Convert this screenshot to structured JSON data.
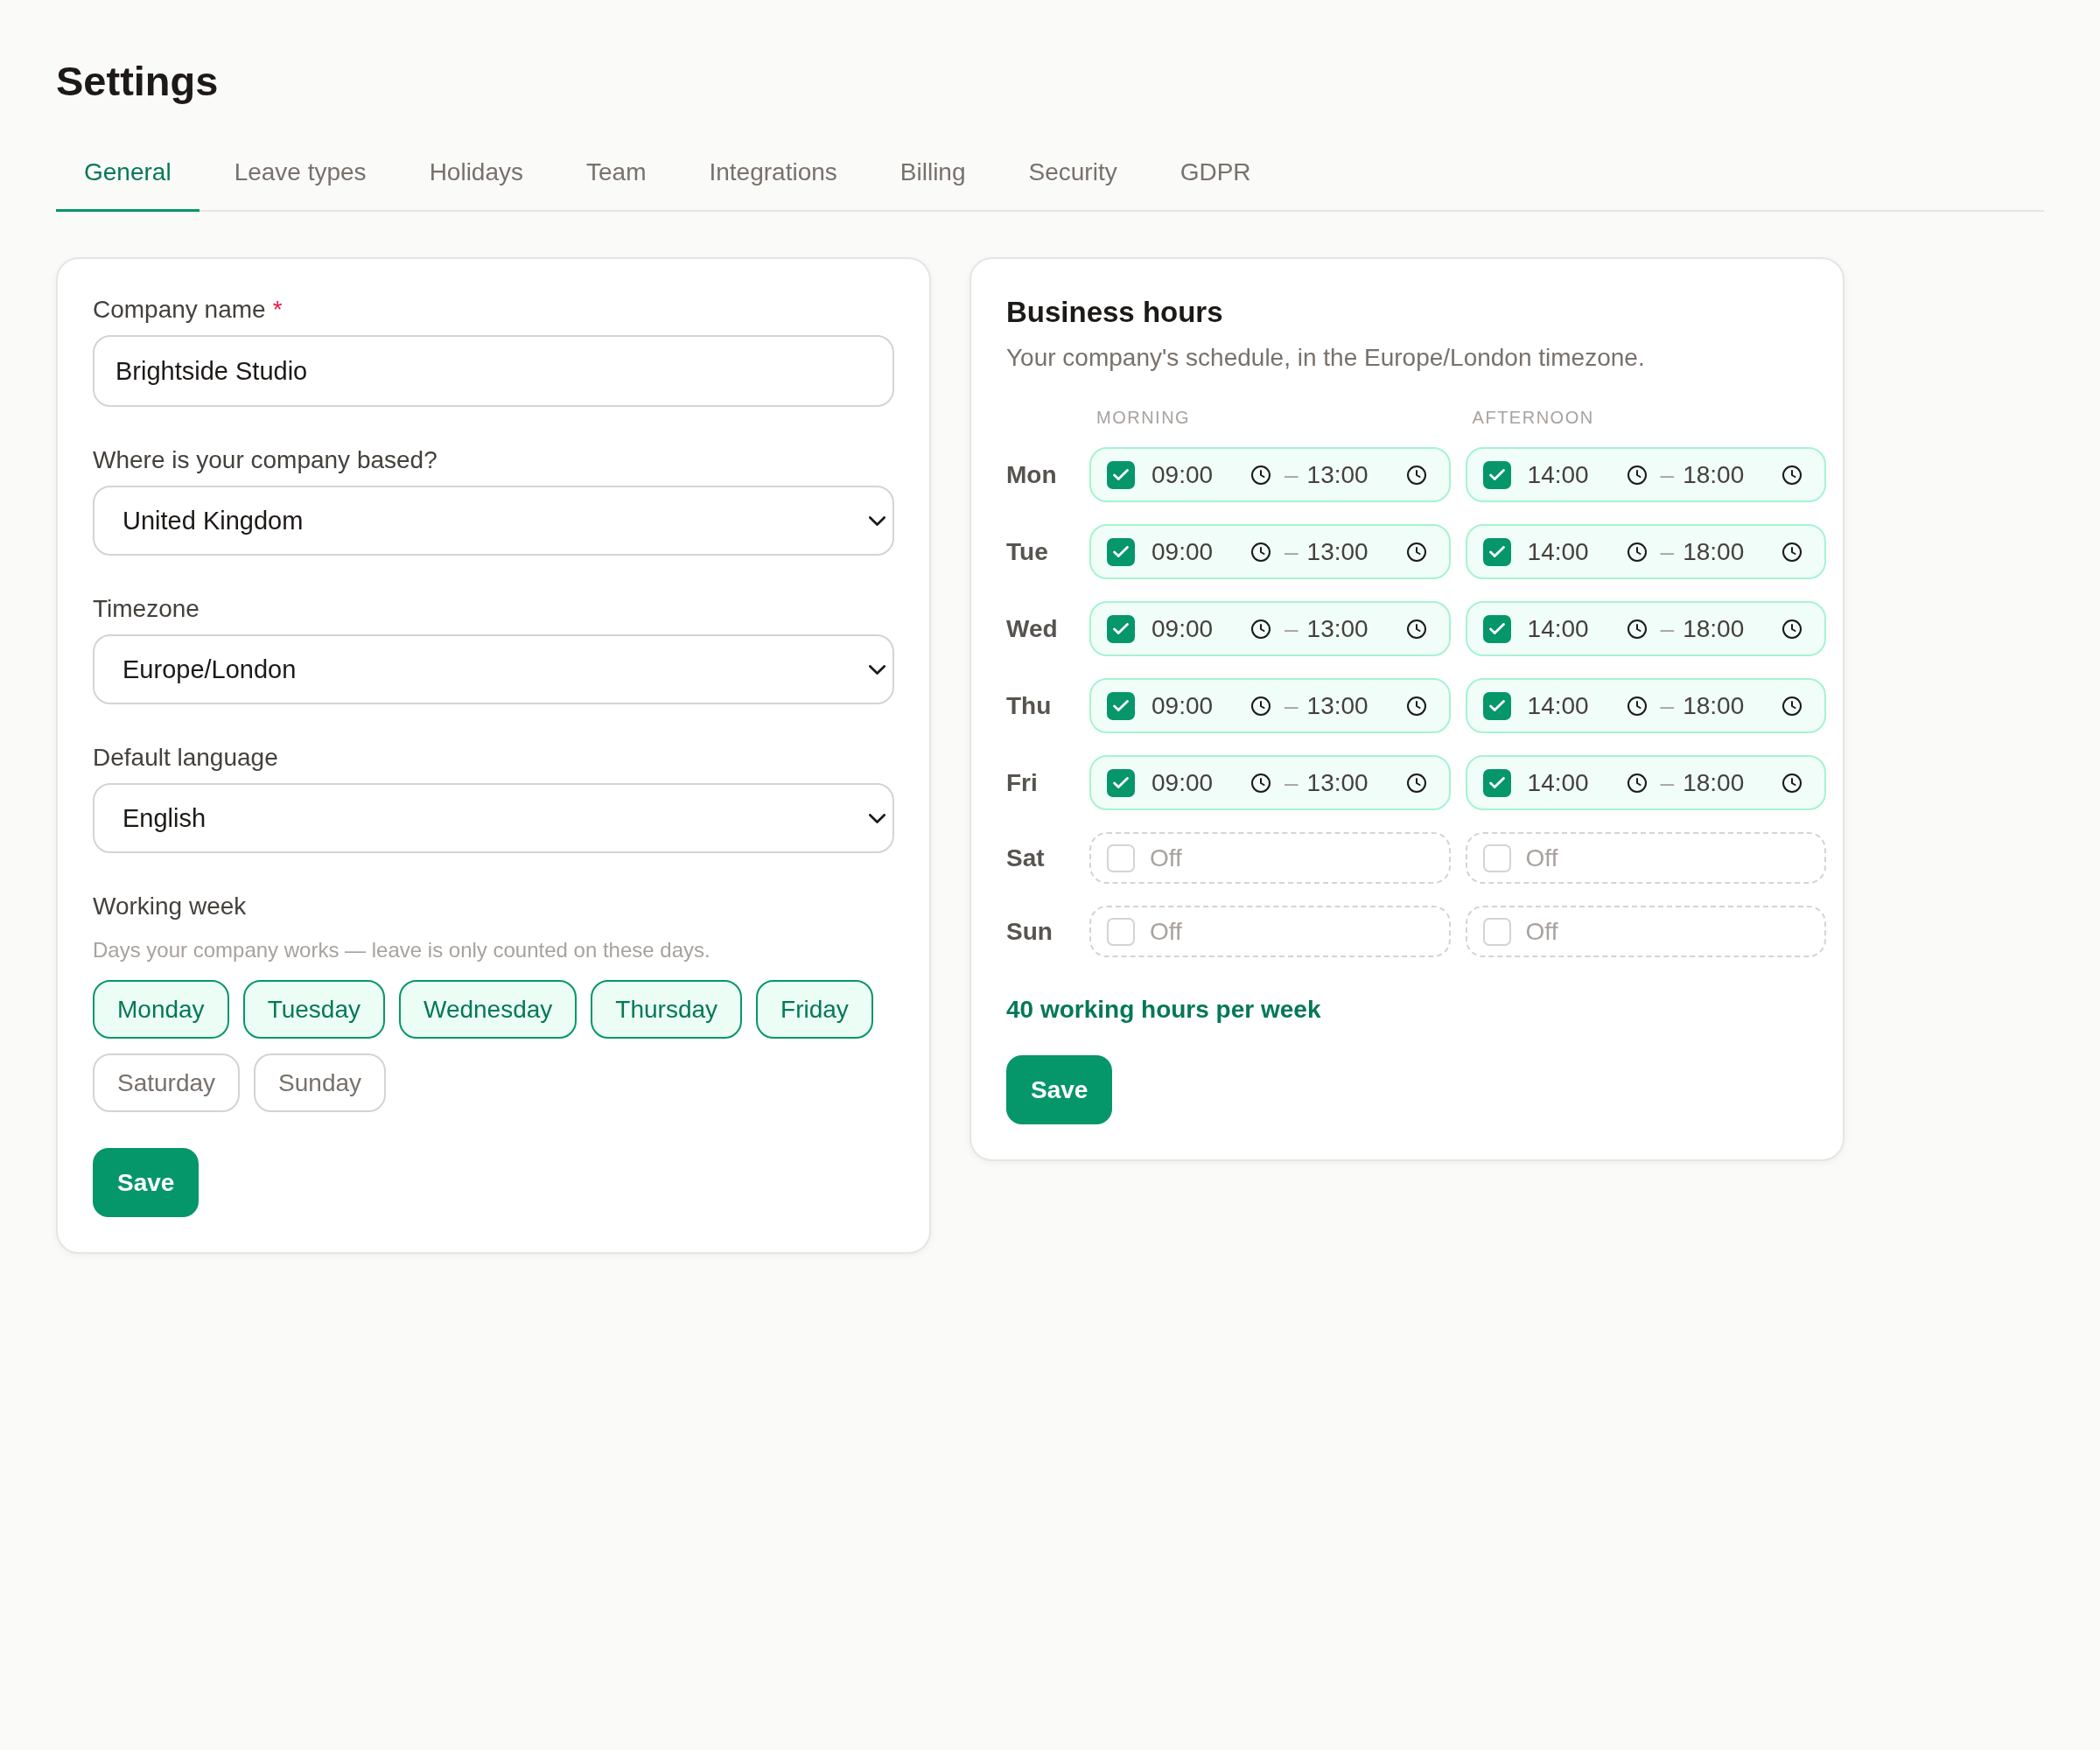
{
  "page": {
    "title": "Settings"
  },
  "tabs": [
    {
      "label": "General",
      "selected": true
    },
    {
      "label": "Leave types",
      "selected": false
    },
    {
      "label": "Holidays",
      "selected": false
    },
    {
      "label": "Team",
      "selected": false
    },
    {
      "label": "Integrations",
      "selected": false
    },
    {
      "label": "Billing",
      "selected": false
    },
    {
      "label": "Security",
      "selected": false
    },
    {
      "label": "GDPR",
      "selected": false
    }
  ],
  "general": {
    "fields": [
      {
        "kind": "text",
        "label": "Company name",
        "required_mark": "*",
        "value": "Brightside Studio"
      },
      {
        "kind": "select",
        "label": "Where is your company based?",
        "value": "United Kingdom"
      },
      {
        "kind": "select",
        "label": "Timezone",
        "value": "Europe/London"
      },
      {
        "kind": "select",
        "label": "Default language",
        "value": "English"
      }
    ],
    "working_week": {
      "label": "Working week",
      "hint": "Days your company works — leave is only counted on these days.",
      "days": [
        {
          "label": "Monday",
          "selected": true
        },
        {
          "label": "Tuesday",
          "selected": true
        },
        {
          "label": "Wednesday",
          "selected": true
        },
        {
          "label": "Thursday",
          "selected": true
        },
        {
          "label": "Friday",
          "selected": true
        },
        {
          "label": "Saturday",
          "selected": false
        },
        {
          "label": "Sunday",
          "selected": false
        }
      ]
    },
    "save_button": "Save"
  },
  "business_hours": {
    "title": "Business hours",
    "subtitle": "Your company's schedule, in the Europe/London timezone.",
    "columns": [
      "MORNING",
      "AFTERNOON"
    ],
    "days": [
      {
        "label": "Mon",
        "slots": [
          {
            "checked": true,
            "start": "09:00",
            "separator": "–",
            "end": "13:00"
          },
          {
            "checked": true,
            "start": "14:00",
            "separator": "–",
            "end": "18:00"
          }
        ]
      },
      {
        "label": "Tue",
        "slots": [
          {
            "checked": true,
            "start": "09:00",
            "separator": "–",
            "end": "13:00"
          },
          {
            "checked": true,
            "start": "14:00",
            "separator": "–",
            "end": "18:00"
          }
        ]
      },
      {
        "label": "Wed",
        "slots": [
          {
            "checked": true,
            "start": "09:00",
            "separator": "–",
            "end": "13:00"
          },
          {
            "checked": true,
            "start": "14:00",
            "separator": "–",
            "end": "18:00"
          }
        ]
      },
      {
        "label": "Thu",
        "slots": [
          {
            "checked": true,
            "start": "09:00",
            "separator": "–",
            "end": "13:00"
          },
          {
            "checked": true,
            "start": "14:00",
            "separator": "–",
            "end": "18:00"
          }
        ]
      },
      {
        "label": "Fri",
        "slots": [
          {
            "checked": true,
            "start": "09:00",
            "separator": "–",
            "end": "13:00"
          },
          {
            "checked": true,
            "start": "14:00",
            "separator": "–",
            "end": "18:00"
          }
        ]
      },
      {
        "label": "Sat",
        "slots": [
          {
            "checked": false,
            "label": "Off"
          },
          {
            "checked": false,
            "label": "Off"
          }
        ]
      },
      {
        "label": "Sun",
        "slots": [
          {
            "checked": false,
            "label": "Off"
          },
          {
            "checked": false,
            "label": "Off"
          }
        ]
      }
    ],
    "total": "40 working hours per week",
    "save_button": "Save"
  }
}
